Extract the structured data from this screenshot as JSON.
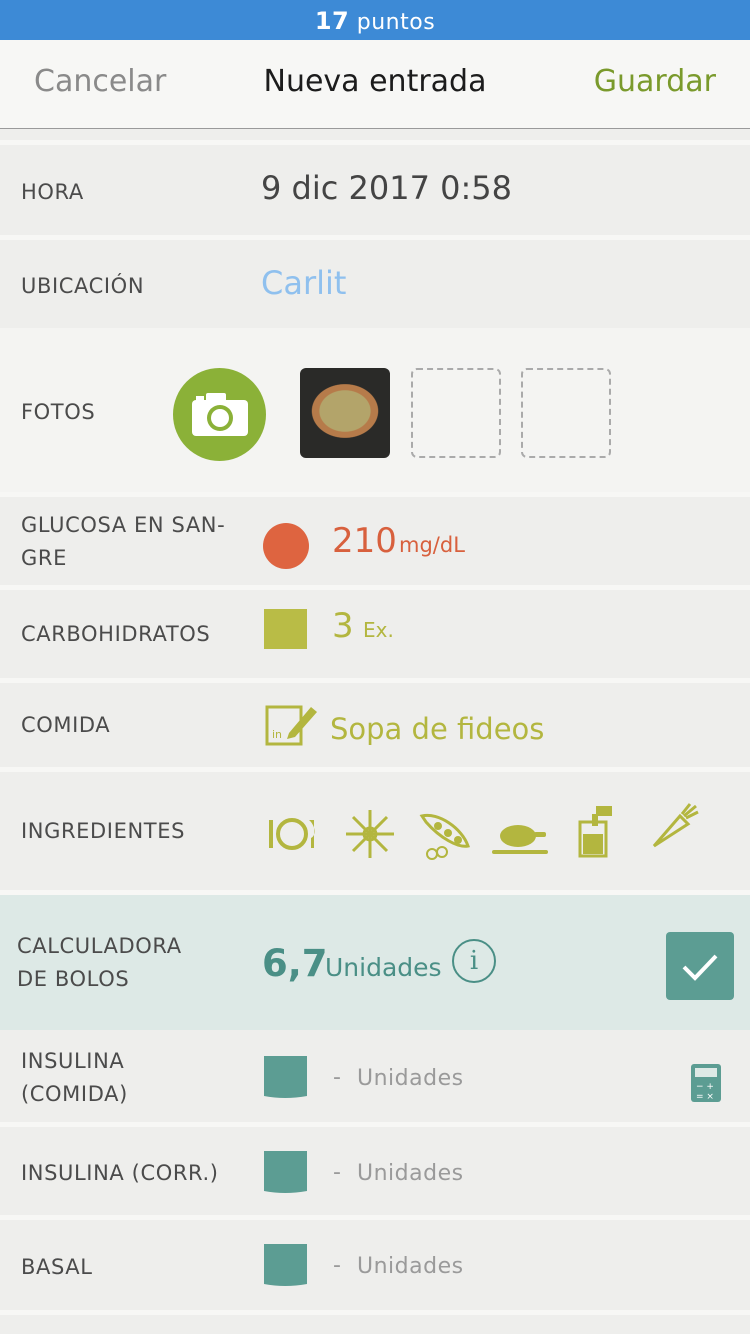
{
  "status": {
    "points_number": "17",
    "points_label": "puntos"
  },
  "nav": {
    "cancel": "Cancelar",
    "title": "Nueva entrada",
    "save": "Guardar"
  },
  "rows": {
    "hora": {
      "label": "HORA",
      "value": "9 dic 2017 0:58"
    },
    "ubicacion": {
      "label": "UBICACIÓN",
      "value": "Carlit"
    },
    "fotos": {
      "label": "FOTOS"
    },
    "glucosa": {
      "label_line1": "GLUCOSA EN SAN-",
      "label_line2": "GRE",
      "value": "210",
      "unit": "mg/dL"
    },
    "carbohidratos": {
      "label": "CARBOHIDRATOS",
      "value": "3",
      "unit": "Ex."
    },
    "comida": {
      "label": "COMIDA",
      "value": "Sopa de fideos"
    },
    "ingredientes": {
      "label": "INGREDIENTES"
    },
    "bolos": {
      "label_line1": "CALCULADORA",
      "label_line2": "DE BOLOS",
      "value": "6,7",
      "unit": "Unidades",
      "info_glyph": "i"
    },
    "insulina_comida": {
      "label_line1": "INSULINA",
      "label_line2": "(COMIDA)",
      "dash": "-",
      "unit": "Unidades"
    },
    "insulina_corr": {
      "label": "INSULINA (CORR.)",
      "dash": "-",
      "unit": "Unidades"
    },
    "basal": {
      "label": "BASAL",
      "dash": "-",
      "unit": "Unidades"
    }
  },
  "colors": {
    "status_bar": "#3d8ad6",
    "accent_green": "#7a9a2c",
    "camera": "#8bb138",
    "glucose_red": "#de6440",
    "carb_olive": "#b9bc46",
    "bolus_teal": "#5c9d93",
    "bolus_bg": "#dde9e6",
    "location_blue": "#8fc0ee"
  }
}
